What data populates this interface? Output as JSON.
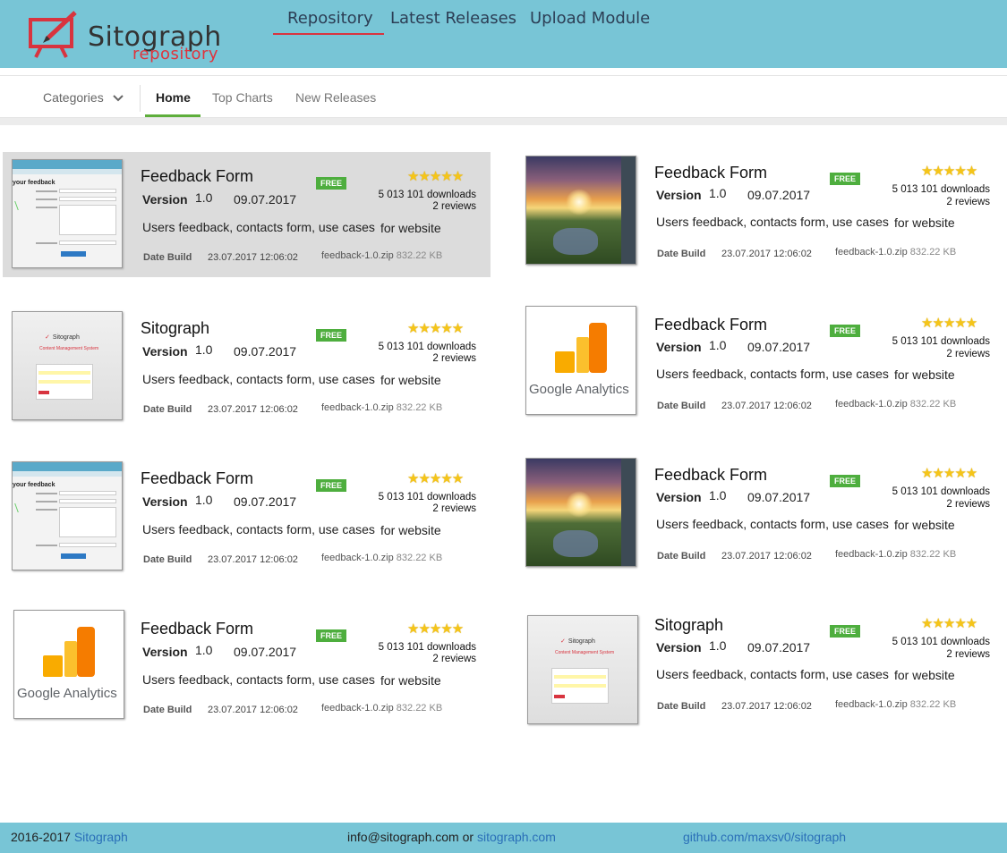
{
  "header": {
    "logo_word": "Sitograph",
    "logo_sub": "repository",
    "nav": [
      "Repository",
      "Latest Releases",
      "Upload Module"
    ],
    "active_nav": "Repository"
  },
  "subnav": {
    "categories_label": "Categories",
    "tabs": [
      "Home",
      "Top Charts",
      "New Releases"
    ],
    "active_tab": "Home"
  },
  "cards": [
    {
      "thumb": "feedback-form-screenshot",
      "title": "Feedback Form",
      "badge": "FREE",
      "rating": 5,
      "stars": "★★★★★",
      "downloads": "5 013 101 downloads",
      "reviews": "2 reviews",
      "version_label": "Version",
      "version": "1.0",
      "date": "09.07.2017",
      "description": "Users feedback, contacts form, use cases",
      "target": "for website",
      "build_label": "Date Build",
      "build_date": "23.07.2017 12:06:02",
      "file": "feedback-1.0.zip",
      "size": "832.22 KB",
      "highlighted": true
    },
    {
      "thumb": "sunset-river-photo",
      "title": "Feedback Form",
      "badge": "FREE",
      "rating": 5,
      "stars": "★★★★★",
      "downloads": "5 013 101 downloads",
      "reviews": "2 reviews",
      "version_label": "Version",
      "version": "1.0",
      "date": "09.07.2017",
      "description": "Users feedback, contacts form, use cases",
      "target": "for website",
      "build_label": "Date Build",
      "build_date": "23.07.2017 12:06:02",
      "file": "feedback-1.0.zip",
      "size": "832.22 KB",
      "highlighted": false
    },
    {
      "thumb": "sitograph-login-screenshot",
      "title": "Sitograph",
      "badge": "FREE",
      "rating": 5,
      "stars": "★★★★★",
      "downloads": "5 013 101 downloads",
      "reviews": "2 reviews",
      "version_label": "Version",
      "version": "1.0",
      "date": "09.07.2017",
      "description": "Users feedback, contacts form, use cases",
      "target": "for website",
      "build_label": "Date Build",
      "build_date": "23.07.2017 12:06:02",
      "file": "feedback-1.0.zip",
      "size": "832.22 KB",
      "highlighted": false
    },
    {
      "thumb": "google-analytics-logo",
      "title": "Feedback Form",
      "badge": "FREE",
      "rating": 5,
      "stars": "★★★★★",
      "downloads": "5 013 101 downloads",
      "reviews": "2 reviews",
      "version_label": "Version",
      "version": "1.0",
      "date": "09.07.2017",
      "description": "Users feedback, contacts form, use cases",
      "target": "for website",
      "build_label": "Date Build",
      "build_date": "23.07.2017 12:06:02",
      "file": "feedback-1.0.zip",
      "size": "832.22 KB",
      "highlighted": false
    },
    {
      "thumb": "feedback-form-screenshot",
      "title": "Feedback Form",
      "badge": "FREE",
      "rating": 5,
      "stars": "★★★★★",
      "downloads": "5 013 101 downloads",
      "reviews": "2 reviews",
      "version_label": "Version",
      "version": "1.0",
      "date": "09.07.2017",
      "description": "Users feedback, contacts form, use cases",
      "target": "for website",
      "build_label": "Date Build",
      "build_date": "23.07.2017 12:06:02",
      "file": "feedback-1.0.zip",
      "size": "832.22 KB",
      "highlighted": false
    },
    {
      "thumb": "sunset-river-photo",
      "title": "Feedback Form",
      "badge": "FREE",
      "rating": 5,
      "stars": "★★★★★",
      "downloads": "5 013 101 downloads",
      "reviews": "2 reviews",
      "version_label": "Version",
      "version": "1.0",
      "date": "09.07.2017",
      "description": "Users feedback, contacts form, use cases",
      "target": "for website",
      "build_label": "Date Build",
      "build_date": "23.07.2017 12:06:02",
      "file": "feedback-1.0.zip",
      "size": "832.22 KB",
      "highlighted": false
    },
    {
      "thumb": "google-analytics-logo",
      "title": "Feedback Form",
      "badge": "FREE",
      "rating": 5,
      "stars": "★★★★★",
      "downloads": "5 013 101 downloads",
      "reviews": "2 reviews",
      "version_label": "Version",
      "version": "1.0",
      "date": "09.07.2017",
      "description": "Users feedback, contacts form, use cases",
      "target": "for website",
      "build_label": "Date Build",
      "build_date": "23.07.2017 12:06:02",
      "file": "feedback-1.0.zip",
      "size": "832.22 KB",
      "highlighted": false
    },
    {
      "thumb": "sitograph-login-screenshot",
      "title": "Sitograph",
      "badge": "FREE",
      "rating": 5,
      "stars": "★★★★★",
      "downloads": "5 013 101 downloads",
      "reviews": "2 reviews",
      "version_label": "Version",
      "version": "1.0",
      "date": "09.07.2017",
      "description": "Users feedback, contacts form, use cases",
      "target": "for website",
      "build_label": "Date Build",
      "build_date": "23.07.2017 12:06:02",
      "file": "feedback-1.0.zip",
      "size": "832.22 KB",
      "highlighted": false
    }
  ],
  "thumb_text": {
    "form_heading": "your feedback",
    "ga_text": "Google Analytics",
    "login_logo": "Sitograph",
    "login_sub": "Content Management System"
  },
  "footer": {
    "copyright": "2016-2017",
    "copyright_link": "Sitograph",
    "email": "info@sitograph.com",
    "or": "or",
    "site_link": "sitograph.com",
    "github_link": "github.com/maxsv0/sitograph"
  },
  "colors": {
    "header_bg": "#78c5d6",
    "accent_red": "#d8343f",
    "active_tab_green": "#5eae3b",
    "free_badge": "#4eae3e",
    "link_blue": "#2a6fb8"
  }
}
